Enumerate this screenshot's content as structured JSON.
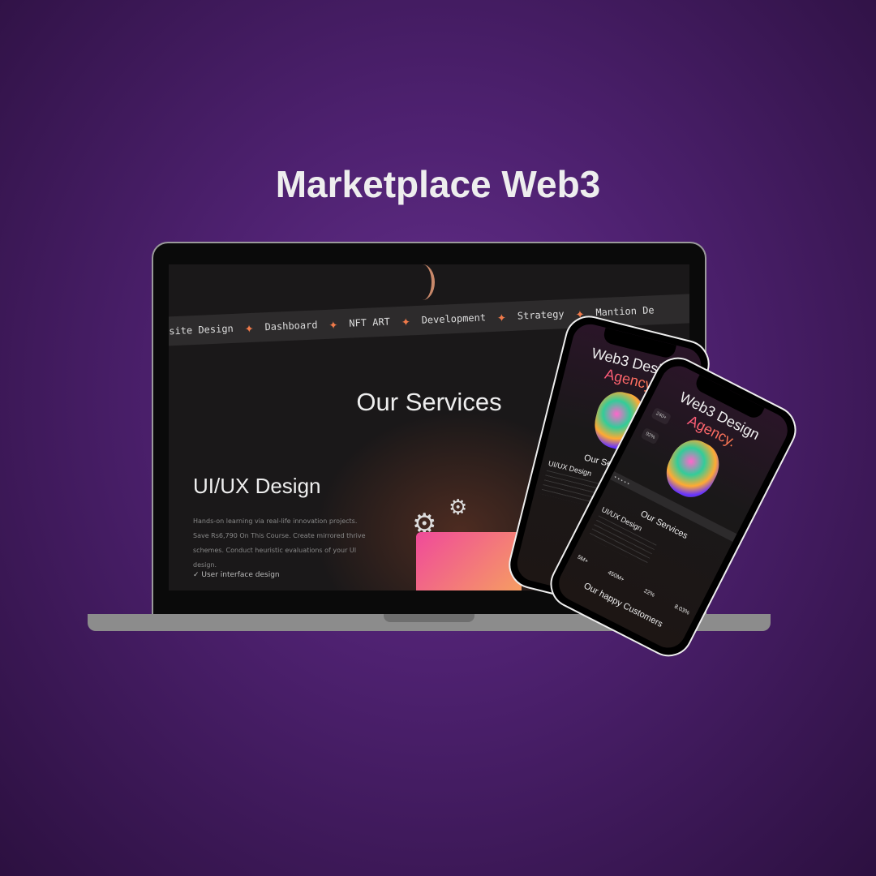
{
  "page_title": "Marketplace Web3",
  "desktop": {
    "ribbon_items": [
      "site Design",
      "Dashboard",
      "NFT ART",
      "Development",
      "Strategy",
      "Mantion De"
    ],
    "section_title": "Our Services",
    "service_title": "UI/UX Design",
    "service_description": "Hands-on learning via real-life innovation projects. Save Rs6,790 On This Course. Create mirrored thrive schemes. Conduct heuristic evaluations of your UI design.",
    "checklist_item": "User interface design"
  },
  "phone": {
    "hero_line1": "Web3 Design",
    "hero_line2": "Agency.",
    "stat1": "240+",
    "stat2": "92%",
    "section_title": "Our Services",
    "service_title": "UI/UX Design",
    "stats": [
      "5M+",
      "450M+",
      "22%",
      "8.03%"
    ],
    "customers_title": "Our happy Customers"
  }
}
